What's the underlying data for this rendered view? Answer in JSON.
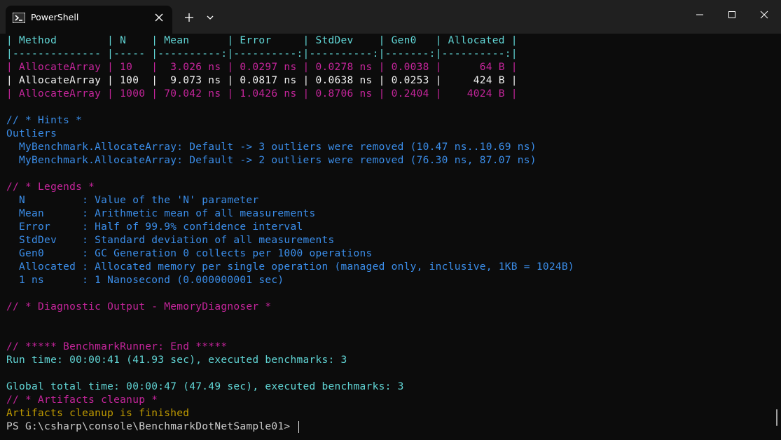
{
  "window": {
    "tab_title": "PowerShell",
    "icons": {
      "tab": "powershell-icon",
      "tab_close": "close-icon",
      "new_tab": "plus-icon",
      "dropdown": "chevron-down-icon",
      "minimize": "minimize-icon",
      "maximize": "maximize-icon",
      "close": "close-icon"
    }
  },
  "colors": {
    "background": "#0c0c0c",
    "titlebar": "#202020",
    "cyan": "#61d6d6",
    "magenta": "#c5259b",
    "white": "#f2f2f2",
    "blue": "#3b8eea",
    "yellow": "#c19c00"
  },
  "terminal": {
    "lines": [
      {
        "name": "table-header",
        "color": "cyan",
        "text": "| Method        | N    | Mean      | Error     | StdDev    | Gen0   | Allocated |"
      },
      {
        "name": "table-separator",
        "color": "cyan",
        "text": "|-------------- |----- |----------:|----------:|----------:|-------:|----------:|"
      },
      {
        "name": "table-row",
        "color": "magenta",
        "text": "| AllocateArray | 10   |  3.026 ns | 0.0297 ns | 0.0278 ns | 0.0038 |      64 B |"
      },
      {
        "name": "table-row",
        "color": "white",
        "text": "| AllocateArray | 100  |  9.073 ns | 0.0817 ns | 0.0638 ns | 0.0253 |     424 B |"
      },
      {
        "name": "table-row",
        "color": "magenta",
        "text": "| AllocateArray | 1000 | 70.042 ns | 1.0426 ns | 0.8706 ns | 0.2404 |    4024 B |"
      },
      {
        "name": "hints-heading",
        "color": "blue",
        "text": "// * Hints *"
      },
      {
        "name": "outliers-heading",
        "color": "blue",
        "text": "Outliers"
      },
      {
        "name": "outlier-line",
        "color": "blue",
        "text": "  MyBenchmark.AllocateArray: Default -> 3 outliers were removed (10.47 ns..10.69 ns)"
      },
      {
        "name": "outlier-line",
        "color": "blue",
        "text": "  MyBenchmark.AllocateArray: Default -> 2 outliers were removed (76.30 ns, 87.07 ns)"
      },
      {
        "name": "legends-heading",
        "color": "magenta",
        "text": "// * Legends *"
      },
      {
        "name": "legend-line",
        "color": "blue",
        "text": "  N         : Value of the 'N' parameter"
      },
      {
        "name": "legend-line",
        "color": "blue",
        "text": "  Mean      : Arithmetic mean of all measurements"
      },
      {
        "name": "legend-line",
        "color": "blue",
        "text": "  Error     : Half of 99.9% confidence interval"
      },
      {
        "name": "legend-line",
        "color": "blue",
        "text": "  StdDev    : Standard deviation of all measurements"
      },
      {
        "name": "legend-line",
        "color": "blue",
        "text": "  Gen0      : GC Generation 0 collects per 1000 operations"
      },
      {
        "name": "legend-line",
        "color": "blue",
        "text": "  Allocated : Allocated memory per single operation (managed only, inclusive, 1KB = 1024B)"
      },
      {
        "name": "legend-line",
        "color": "blue",
        "text": "  1 ns      : 1 Nanosecond (0.000000001 sec)"
      },
      {
        "name": "diagnostic-heading",
        "color": "magenta",
        "text": "// * Diagnostic Output - MemoryDiagnoser *"
      },
      {
        "name": "runner-end-line",
        "color": "magenta",
        "text": "// ***** BenchmarkRunner: End *****"
      },
      {
        "name": "run-time-line",
        "color": "cyan",
        "text": "Run time: 00:00:41 (41.93 sec), executed benchmarks: 3"
      },
      {
        "name": "global-time-line",
        "color": "cyan",
        "text": "Global total time: 00:00:47 (47.49 sec), executed benchmarks: 3"
      },
      {
        "name": "artifacts-heading",
        "color": "magenta",
        "text": "// * Artifacts cleanup *"
      },
      {
        "name": "artifacts-finished-line",
        "color": "yellow",
        "text": "Artifacts cleanup is finished"
      }
    ],
    "prompt": "PS G:\\csharp\\console\\BenchmarkDotNetSample01> "
  }
}
